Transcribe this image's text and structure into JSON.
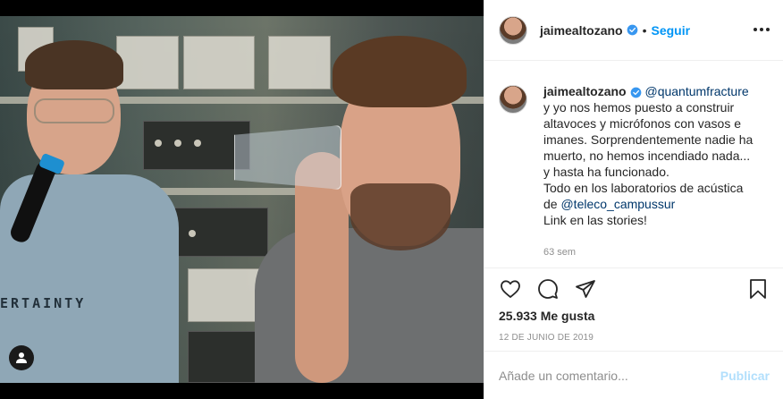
{
  "post": {
    "username": "jaimealtozano",
    "follow_label": "Seguir",
    "separator": "•",
    "shirt_text": "ERTAINTY"
  },
  "caption": {
    "username": "jaimealtozano",
    "mention_quantum": "@quantumfracture",
    "text_1": " y yo nos hemos puesto a construir altavoces y micrófonos con vasos e imanes. Sorprendentemente nadie ha muerto, no hemos incendiado nada... y hasta ha funcionado.\nTodo en los laboratorios de acústica de ",
    "mention_teleco": "@teleco_campussur",
    "text_2": "\nLink en las stories!",
    "time_ago": "63 sem"
  },
  "actions": {
    "likes": "25.933 Me gusta",
    "date": "12 DE JUNIO DE 2019"
  },
  "comment": {
    "placeholder": "Añade un comentario...",
    "publish_label": "Publicar"
  },
  "colors": {
    "accent": "#0095f6",
    "publish_disabled": "#b2dffc",
    "mention": "#00376b",
    "muted": "#8e8e8e"
  },
  "icons": {
    "verified": "verified-badge-icon",
    "more": "more-options-icon",
    "like": "heart-icon",
    "comment": "comment-bubble-icon",
    "share": "paper-plane-icon",
    "save": "bookmark-icon",
    "user_tag": "user-tag-icon"
  }
}
